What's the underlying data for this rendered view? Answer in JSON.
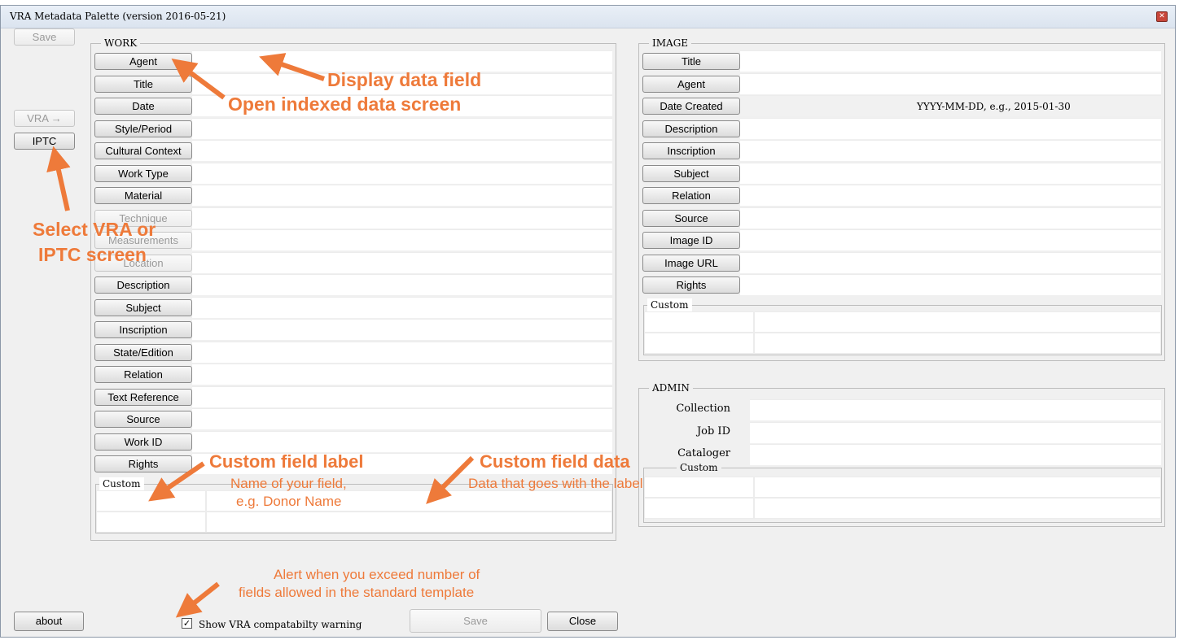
{
  "window": {
    "title": "VRA Metadata Palette  (version 2016-05-21)",
    "close_glyph": "✕"
  },
  "left": {
    "save_top": "Save",
    "vra": "VRA →",
    "iptc": "IPTC",
    "about": "about"
  },
  "work": {
    "title": "WORK",
    "buttons": [
      "Agent",
      "Title",
      "Date",
      "Style/Period",
      "Cultural Context",
      "Work Type",
      "Material",
      "Technique",
      "Measurements",
      "Location",
      "Description",
      "Subject",
      "Inscription",
      "State/Edition",
      "Relation",
      "Text Reference",
      "Source",
      "Work ID",
      "Rights"
    ],
    "custom_title": "Custom"
  },
  "image": {
    "title": "IMAGE",
    "buttons": [
      "Title",
      "Agent",
      "Date Created",
      "Description",
      "Inscription",
      "Subject",
      "Relation",
      "Source",
      "Image ID",
      "Image URL",
      "Rights"
    ],
    "date_hint": "YYYY-MM-DD, e.g., 2015-01-30",
    "custom_title": "Custom"
  },
  "admin": {
    "title": "ADMIN",
    "labels": [
      "Collection",
      "Job ID",
      "Cataloger"
    ],
    "custom_title": "Custom"
  },
  "bottom": {
    "checkbox_label": "Show VRA compatabilty warning",
    "checked": true,
    "check_glyph": "✓",
    "save": "Save",
    "close": "Close"
  },
  "annotations": {
    "display_field": "Display data field",
    "open_screen": "Open indexed data screen",
    "select_line1": "Select VRA or",
    "select_line2": "IPTC  screen",
    "custom_label": "Custom field label",
    "custom_label_sub1": "Name of your field,",
    "custom_label_sub2": "e.g. Donor Name",
    "custom_data": "Custom field data",
    "custom_data_sub": "Data that goes with the label",
    "alert_line1": "Alert when you exceed number of",
    "alert_line2": "fields allowed in the standard template",
    "color": "#ee7a3a"
  }
}
